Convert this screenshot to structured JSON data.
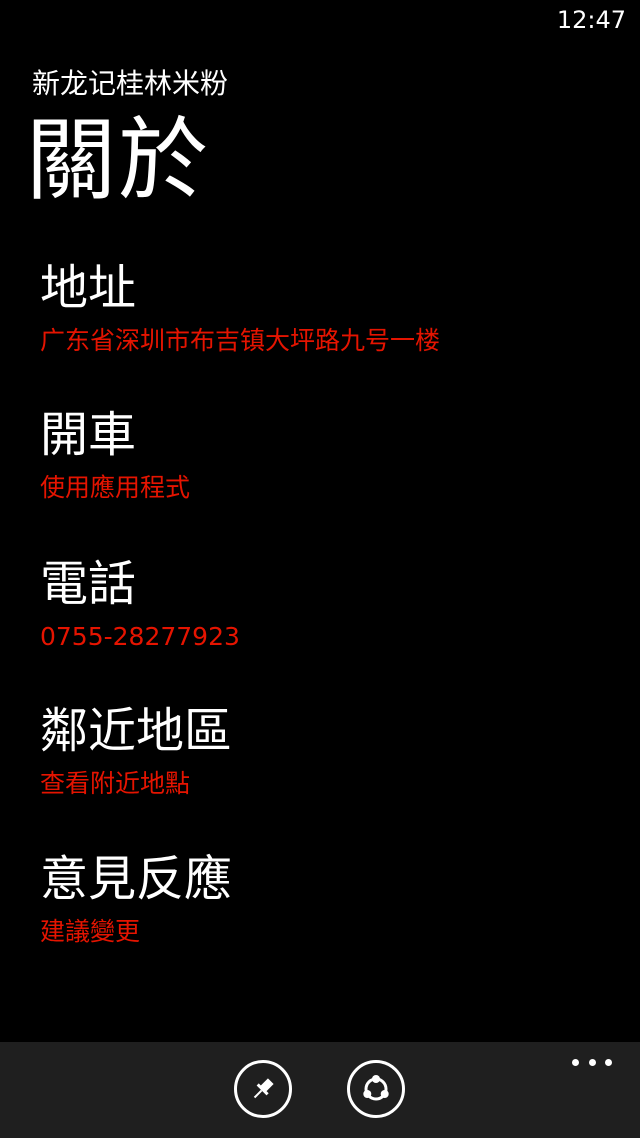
{
  "status_bar": {
    "time": "12:47"
  },
  "header": {
    "app_title": "新龙记桂林米粉",
    "page_title": "關於"
  },
  "menu": {
    "items": [
      {
        "title": "地址",
        "subtitle": "广东省深圳市布吉镇大坪路九号一楼"
      },
      {
        "title": "開車",
        "subtitle": "使用應用程式"
      },
      {
        "title": "電話",
        "subtitle": "0755-28277923"
      },
      {
        "title": "鄰近地區",
        "subtitle": "查看附近地點"
      },
      {
        "title": "意見反應",
        "subtitle": "建議變更"
      }
    ]
  },
  "app_bar": {
    "buttons": [
      {
        "icon": "pin-icon"
      },
      {
        "icon": "share-icon"
      }
    ],
    "more_icon": "ellipsis-icon"
  },
  "colors": {
    "accent": "#e51400",
    "background": "#000000",
    "app_bar": "#1f1f1f",
    "text": "#ffffff"
  }
}
